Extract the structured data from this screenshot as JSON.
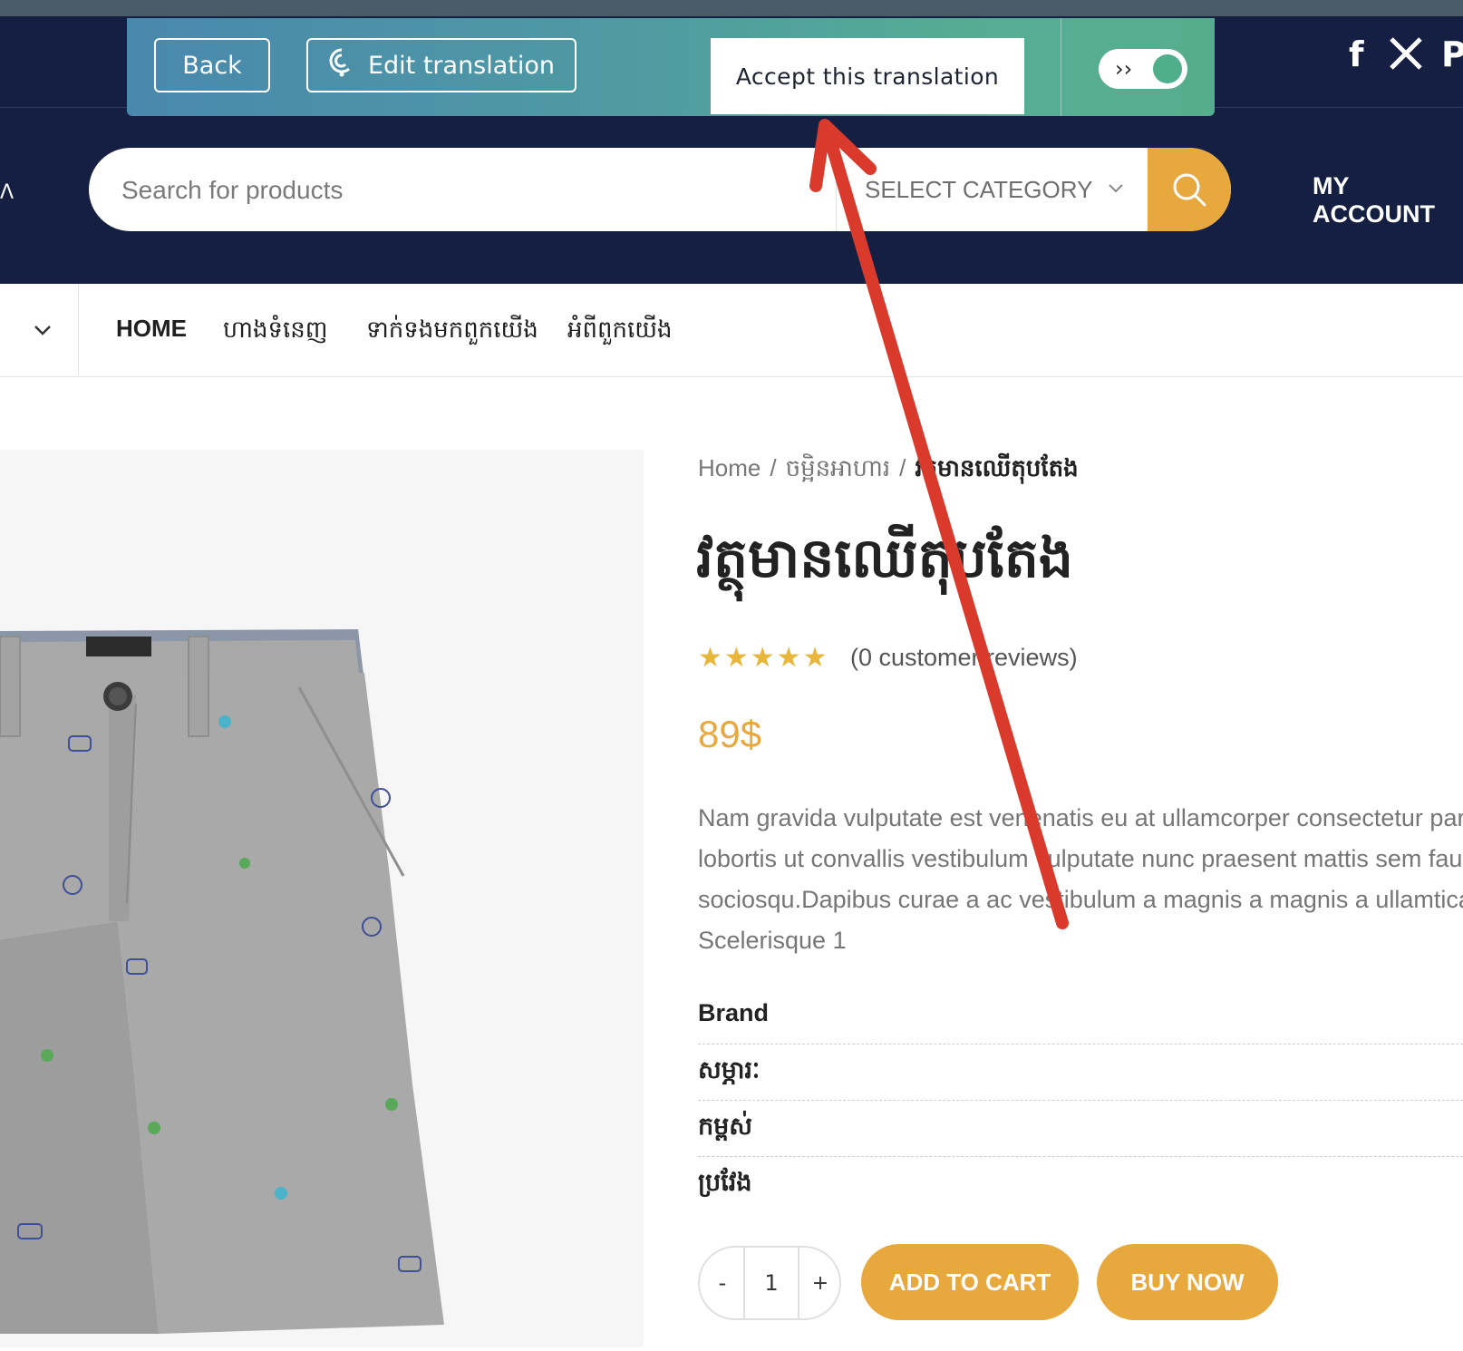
{
  "translation_bar": {
    "back_label": "Back",
    "edit_label": "Edit translation",
    "accept_label": "Accept this translation",
    "toggle_on": true
  },
  "social": {
    "icons": [
      "facebook-icon",
      "x-icon",
      "pinterest-icon"
    ]
  },
  "header": {
    "search_placeholder": "Search for products",
    "category_label": "SELECT CATEGORY",
    "my_account_label": "MY ACCOUNT"
  },
  "nav": {
    "items": [
      {
        "label": "HOME"
      },
      {
        "label": "ហាងទំនេញ"
      },
      {
        "label": "ទាក់ទងមកពួកយើង"
      },
      {
        "label": "អំពីពួកយើង"
      }
    ]
  },
  "breadcrumb": {
    "home": "Home",
    "category": "ចម្អិនអាហារ",
    "current": "វត្ថុមានឈើតុបតែង"
  },
  "product": {
    "title": "វត្ថុមានឈើតុបតែង",
    "rating": 5,
    "reviews_text": "(0 customer reviews)",
    "price": "89$",
    "description": [
      "Nam gravida vulputate est venenatis eu at ullamcorper consectetur parturient",
      "lobortis ut convallis vestibulum vulputate nunc praesent mattis sem faucibus",
      "sociosqu.Dapibus curae a ac vestibulum a magnis a magnis a ullamtica feugiat",
      "Scelerisque 1"
    ],
    "attributes": [
      "Brand",
      "សម្ភារៈ",
      "កម្ពស់",
      "ប្រវែង"
    ],
    "quantity": "1",
    "minus": "-",
    "plus": "+",
    "add_to_cart": "ADD TO CART",
    "buy_now": "BUY NOW"
  },
  "colors": {
    "navy": "#141f41",
    "accent": "#e7a83e",
    "annotation_arrow": "#d93a2b"
  }
}
